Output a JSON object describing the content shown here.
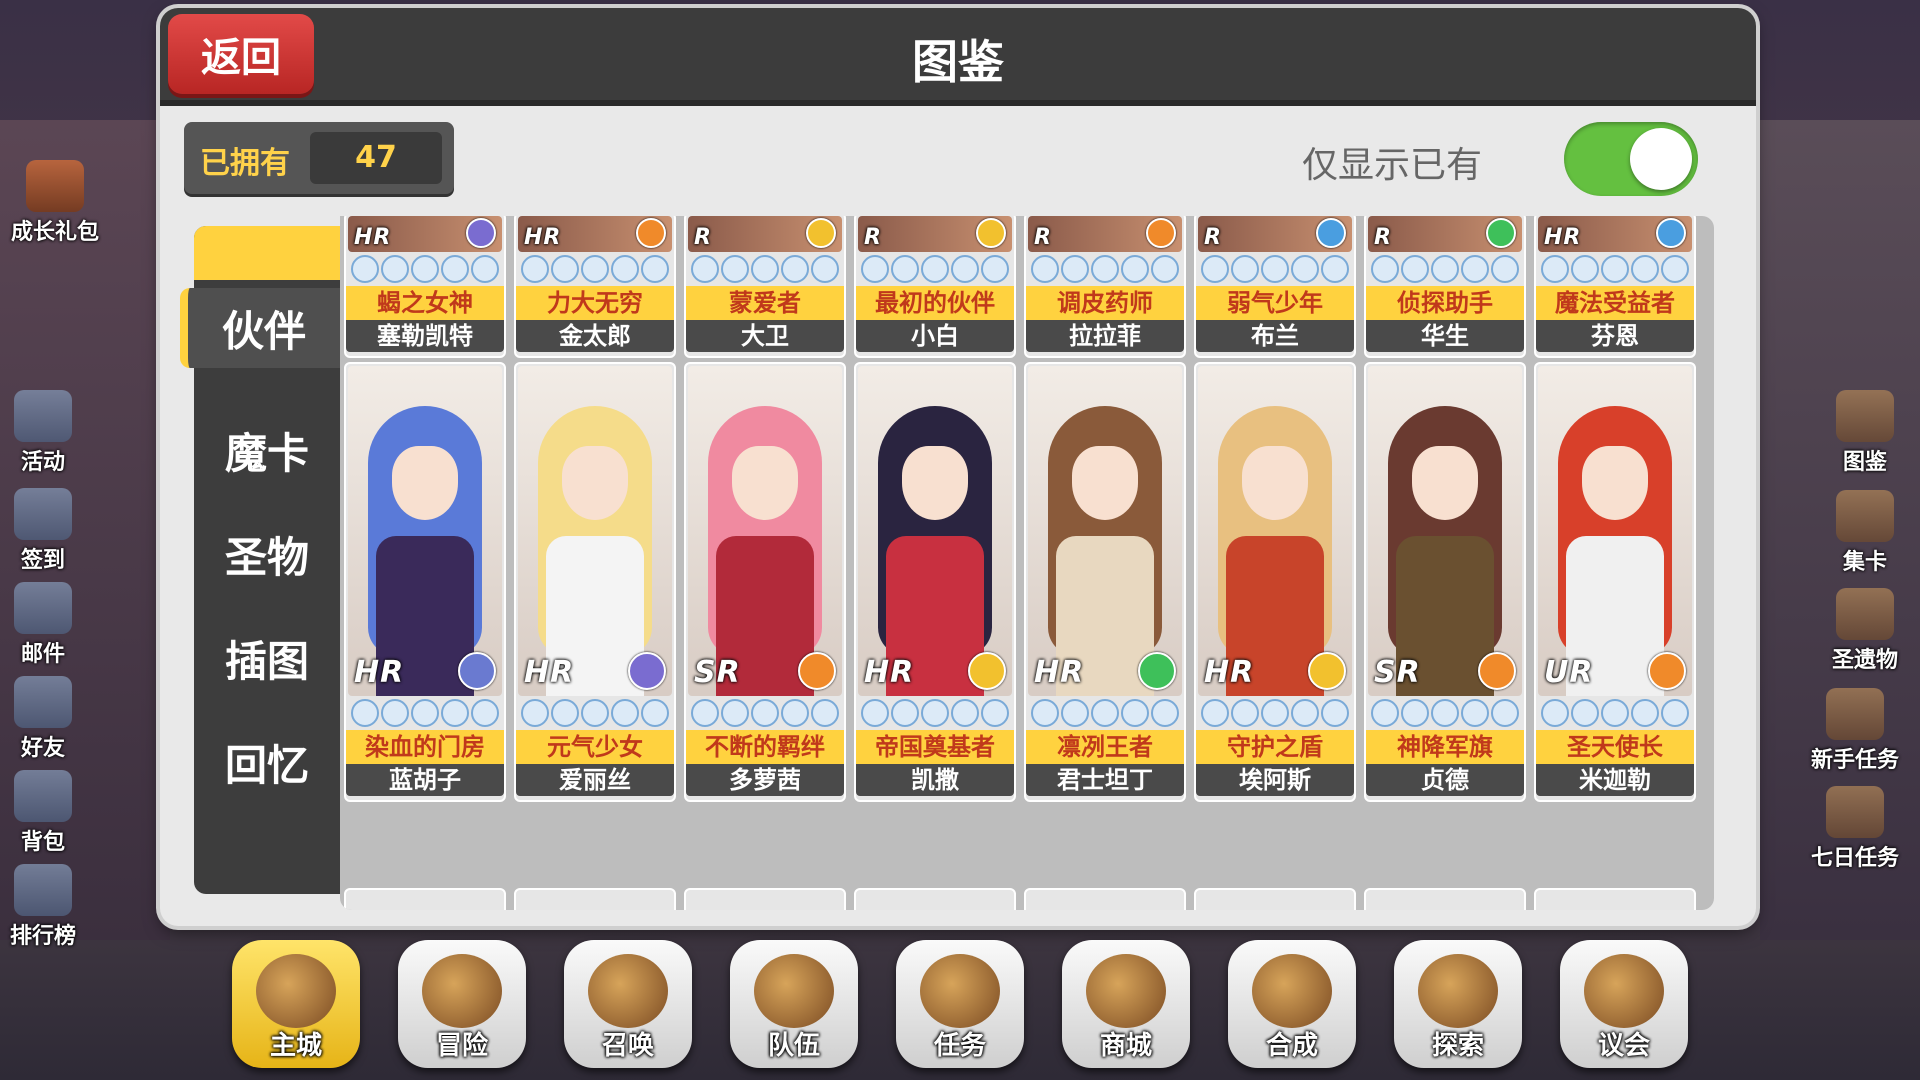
{
  "header": {
    "title": "图鉴",
    "back_label": "返回"
  },
  "owned": {
    "label": "已拥有",
    "count": "47"
  },
  "filter": {
    "label": "仅显示已有",
    "enabled": true,
    "on_color": "#64c040"
  },
  "tabs": [
    {
      "label": "伙伴",
      "active": true
    },
    {
      "label": "魔卡",
      "active": false
    },
    {
      "label": "圣物",
      "active": false
    },
    {
      "label": "插图",
      "active": false
    },
    {
      "label": "回忆",
      "active": false
    }
  ],
  "left_menu": [
    "成长礼包",
    "活动",
    "签到",
    "邮件",
    "好友",
    "背包",
    "排行榜"
  ],
  "right_menu": [
    "图鉴",
    "集卡",
    "圣遗物",
    "新手任务",
    "七日任务"
  ],
  "row1": [
    {
      "rarity": "HR",
      "title": "蝎之女神",
      "name": "塞勒凯特",
      "elem": "#7a6cd0"
    },
    {
      "rarity": "HR",
      "title": "力大无穷",
      "name": "金太郎",
      "elem": "#f08a2a"
    },
    {
      "rarity": "R",
      "title": "蒙爱者",
      "name": "大卫",
      "elem": "#f2c12e"
    },
    {
      "rarity": "R",
      "title": "最初的伙伴",
      "name": "小白",
      "elem": "#f2c12e"
    },
    {
      "rarity": "R",
      "title": "调皮药师",
      "name": "拉拉菲",
      "elem": "#f08a2a"
    },
    {
      "rarity": "R",
      "title": "弱气少年",
      "name": "布兰",
      "elem": "#4a9ee0"
    },
    {
      "rarity": "R",
      "title": "侦探助手",
      "name": "华生",
      "elem": "#3ec05a"
    },
    {
      "rarity": "HR",
      "title": "魔法受益者",
      "name": "芬恩",
      "elem": "#4a9ee0"
    }
  ],
  "row2": [
    {
      "rarity": "HR",
      "title": "染血的门房",
      "name": "蓝胡子",
      "elem": "#6a7ad0",
      "hair": "#5a7ad8",
      "body": "#3a2a5a"
    },
    {
      "rarity": "HR",
      "title": "元气少女",
      "name": "爱丽丝",
      "elem": "#7a6cd0",
      "hair": "#f5dc8a",
      "body": "#f4f4f4"
    },
    {
      "rarity": "SR",
      "title": "不断的羁绊",
      "name": "多萝茜",
      "elem": "#f08a2a",
      "hair": "#f08aa0",
      "body": "#b22a3a"
    },
    {
      "rarity": "HR",
      "title": "帝国奠基者",
      "name": "凯撒",
      "elem": "#f2c12e",
      "hair": "#2a2440",
      "body": "#c83040"
    },
    {
      "rarity": "HR",
      "title": "凛冽王者",
      "name": "君士坦丁",
      "elem": "#3ec05a",
      "hair": "#8a5a3a",
      "body": "#e8d8c0"
    },
    {
      "rarity": "HR",
      "title": "守护之盾",
      "name": "埃阿斯",
      "elem": "#f2c12e",
      "hair": "#e8c080",
      "body": "#c8442a"
    },
    {
      "rarity": "SR",
      "title": "神降军旗",
      "name": "贞德",
      "elem": "#f08a2a",
      "hair": "#6a3a30",
      "body": "#6a5030"
    },
    {
      "rarity": "UR",
      "title": "圣天使长",
      "name": "米迦勒",
      "elem": "#f08a2a",
      "hair": "#d8402a",
      "body": "#f0f0f0"
    }
  ],
  "bottom_nav": [
    {
      "label": "主城",
      "active": true
    },
    {
      "label": "冒险",
      "active": false
    },
    {
      "label": "召唤",
      "active": false
    },
    {
      "label": "队伍",
      "active": false
    },
    {
      "label": "任务",
      "active": false
    },
    {
      "label": "商城",
      "active": false
    },
    {
      "label": "合成",
      "active": false
    },
    {
      "label": "探索",
      "active": false
    },
    {
      "label": "议会",
      "active": false
    }
  ]
}
